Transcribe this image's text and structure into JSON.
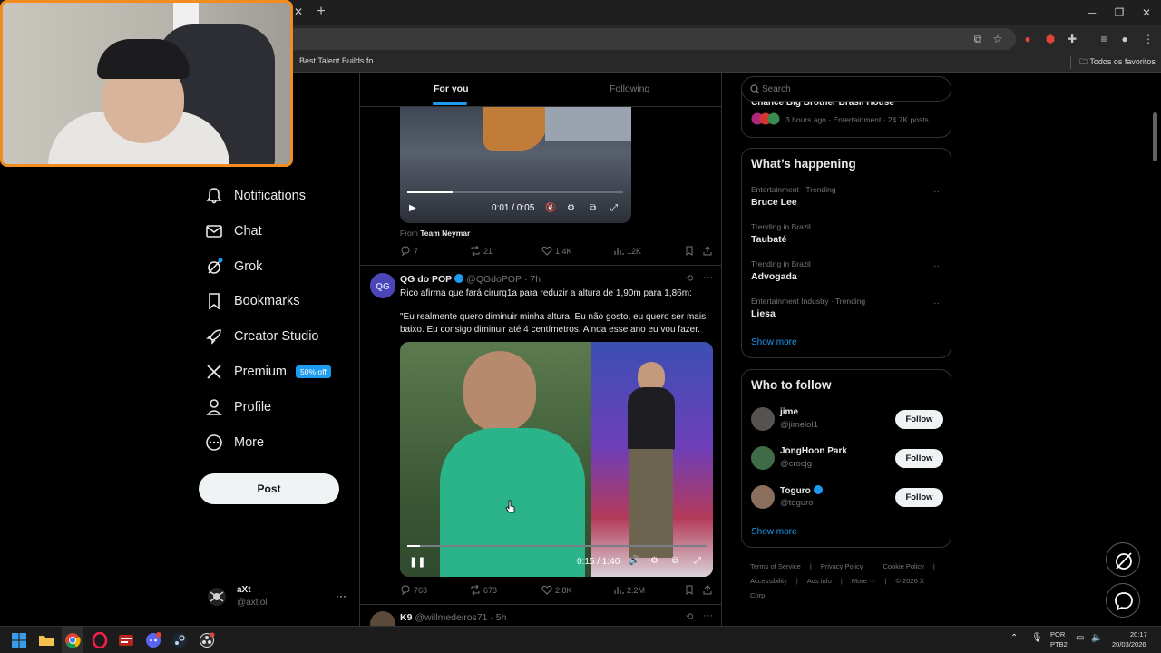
{
  "browser": {
    "bookmark_item": "Best Talent Builds fo...",
    "bookmarks_all": "Todos os favoritos"
  },
  "nav": {
    "items": [
      {
        "label": "Notifications",
        "icon": "bell-icon"
      },
      {
        "label": "Chat",
        "icon": "envelope-icon"
      },
      {
        "label": "Grok",
        "icon": "grok-icon"
      },
      {
        "label": "Bookmarks",
        "icon": "bookmark-icon"
      },
      {
        "label": "Creator Studio",
        "icon": "rocket-icon"
      },
      {
        "label": "Premium",
        "icon": "x-logo-icon"
      },
      {
        "label": "Profile",
        "icon": "person-icon"
      },
      {
        "label": "More",
        "icon": "more-circle-icon"
      }
    ],
    "premium_badge": "50% off",
    "post_label": "Post",
    "account": {
      "name": "aXt",
      "handle": "@axtiol"
    }
  },
  "feed": {
    "tabs": {
      "active": "For you",
      "inactive": "Following"
    },
    "tweet1": {
      "video_time": "0:01 / 0:05",
      "from_prefix": "From",
      "from_name": "Team Neymar",
      "replies": "7",
      "reposts": "21",
      "likes": "1.4K",
      "views": "12K"
    },
    "tweet2": {
      "name": "QG do POP",
      "handle": "@QGdoPOP",
      "time": "· 7h",
      "text1": "Rico afirma que fará cirurg1a para reduzir a altura de 1,90m para 1,86m:",
      "text2": "\"Eu realmente quero diminuir minha altura. Eu não gosto, eu quero ser mais baixo. Eu consigo diminuir até 4 centímetros. Ainda esse ano eu vou fazer.",
      "video_time": "0:15 / 1:40",
      "replies": "763",
      "reposts": "673",
      "likes": "2.8K",
      "views": "2.2M"
    },
    "tweet3": {
      "name": "K9",
      "handle": "@willmedeiros71",
      "time": "· 5h"
    }
  },
  "sidebar": {
    "search_placeholder": "Search",
    "top_trend": {
      "title": "Chance Big Brother Brasil House",
      "meta": "3 hours ago · Entertainment · 24.7K posts"
    },
    "happening_title": "What’s happening",
    "trends": [
      {
        "context": "Entertainment · Trending",
        "name": "Bruce Lee"
      },
      {
        "context": "Trending in Brazil",
        "name": "Taubaté"
      },
      {
        "context": "Trending in Brazil",
        "name": "Advogada"
      },
      {
        "context": "Entertainment Industry · Trending",
        "name": "Liesa"
      }
    ],
    "show_more": "Show more",
    "who_title": "Who to follow",
    "who": [
      {
        "name": "jime",
        "handle": "@jimelol1",
        "follow": "Follow"
      },
      {
        "name": "JongHoon Park",
        "handle": "@crocjg",
        "follow": "Follow"
      },
      {
        "name": "Toguro",
        "handle": "@toguro",
        "follow": "Follow"
      }
    ],
    "footer": [
      "Terms of Service",
      "Privacy Policy",
      "Cookie Policy",
      "Accessibility",
      "Ads info",
      "More ···",
      "© 2026 X Corp."
    ]
  },
  "taskbar": {
    "lang1": "POR",
    "lang2": "PTB2",
    "time": "20:17",
    "date": "20/03/2026"
  },
  "colors": {
    "accent": "#1d9bf0",
    "webcam_border": "#f28c1e"
  }
}
